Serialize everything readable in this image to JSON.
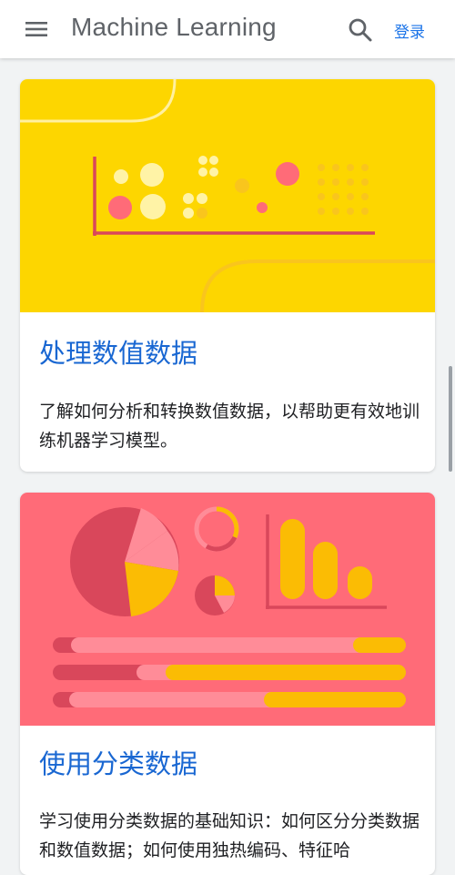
{
  "header": {
    "title": "Machine Learning",
    "login_label": "登录",
    "icons": [
      "menu-icon",
      "search-icon"
    ]
  },
  "cards": [
    {
      "title": "处理数值数据",
      "description": "了解如何分析和转换数值数据，以帮助更有效地训练机器学习模型。",
      "banner_color": "#fdd600"
    },
    {
      "title": "使用分类数据",
      "description": "学习使用分类数据的基础知识：如何区分分类数据和数值数据；如何使用独热编码、特征哈",
      "banner_color": "#ff6b78"
    }
  ],
  "colors": {
    "accent": "#1a73e8",
    "card_title": "#1967d2",
    "yellow": "#fdd600",
    "coral": "#ff6b78",
    "background": "#f1f3f4"
  }
}
